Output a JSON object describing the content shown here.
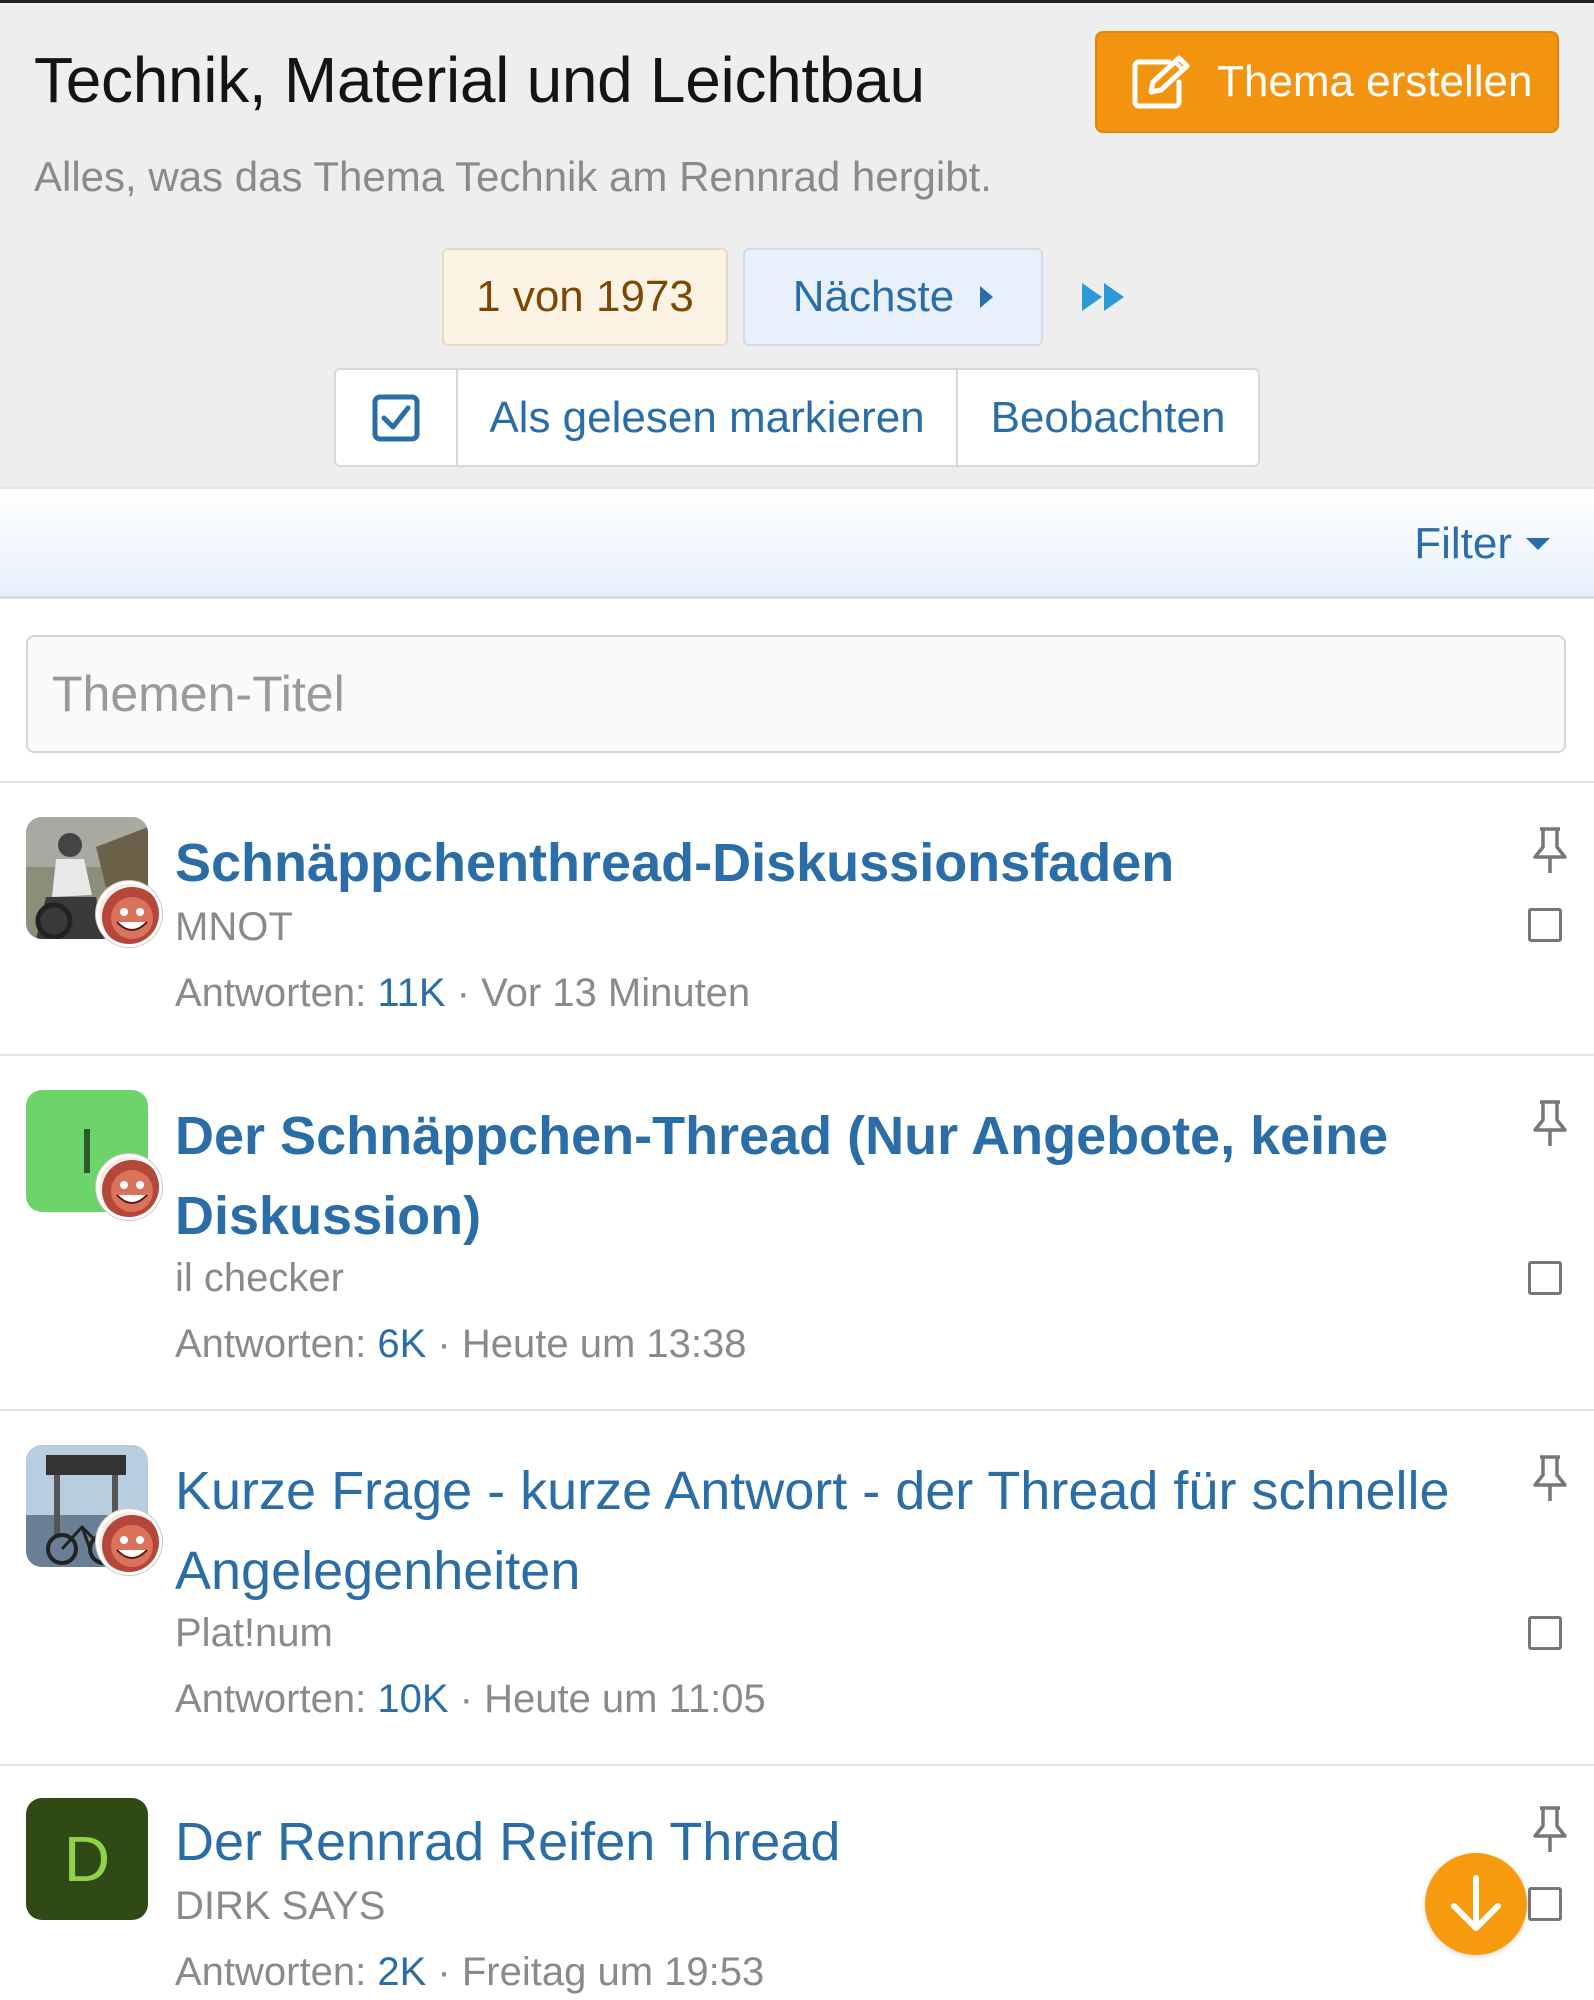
{
  "forum": {
    "title": "Technik, Material und Leichtbau",
    "description": "Alles, was das Thema Technik am Rennrad hergibt."
  },
  "toolbar": {
    "create_label": "Thema erstellen",
    "pager_current": "1 von 1973",
    "pager_next": "Nächste",
    "mark_read": "Als gelesen markieren",
    "watch": "Beobachten",
    "filter": "Filter"
  },
  "search": {
    "placeholder": "Themen-Titel"
  },
  "threads": [
    {
      "title": "Schnäppchenthread-Diskussionsfaden",
      "author": "MNOT",
      "replies_label": "Antworten:",
      "replies": "11K",
      "time": "Vor 13 Minuten",
      "avatar": "photo"
    },
    {
      "title": "Der Schnäppchen-Thread (Nur Angebote, keine Diskussion)",
      "author": "il checker",
      "replies_label": "Antworten:",
      "replies": "6K",
      "time": "Heute um 13:38",
      "avatar_letter": "I",
      "avatar_color": "#6dd46a"
    },
    {
      "title": "Kurze Frage - kurze Antwort - der Thread für schnelle Angelegenheiten",
      "author": "Plat!num",
      "replies_label": "Antworten:",
      "replies": "10K",
      "time": "Heute um 11:05",
      "avatar": "photo"
    },
    {
      "title": "Der Rennrad Reifen Thread",
      "author": "DIRK SAYS",
      "replies_label": "Antworten:",
      "replies": "2K",
      "time": "Freitag um 19:53",
      "avatar_letter": "D",
      "avatar_color": "#2f4a14"
    }
  ],
  "colors": {
    "accent_orange": "#f2940f",
    "link_blue": "#2b6da6"
  }
}
